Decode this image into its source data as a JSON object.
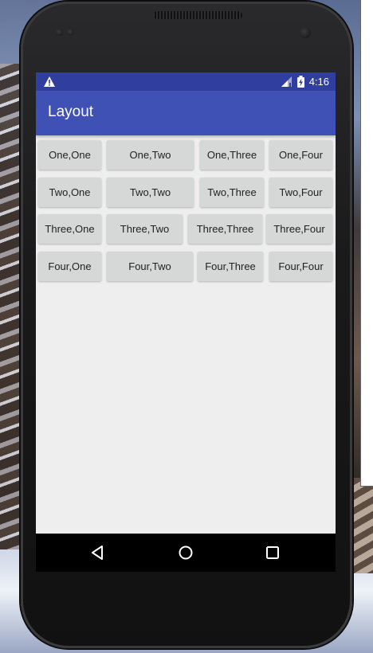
{
  "status_bar": {
    "time": "4:16",
    "icons": [
      "warning-icon",
      "signal-icon",
      "battery-charging-icon"
    ]
  },
  "app_bar": {
    "title": "Layout"
  },
  "grid": {
    "rows": [
      [
        "One,One",
        "One,Two",
        "One,Three",
        "One,Four"
      ],
      [
        "Two,One",
        "Two,Two",
        "Two,Three",
        "Two,Four"
      ],
      [
        "Three,One",
        "Three,Two",
        "Three,Three",
        "Three,Four"
      ],
      [
        "Four,One",
        "Four,Two",
        "Four,Three",
        "Four,Four"
      ]
    ]
  },
  "nav_bar": {
    "icons": [
      "back-icon",
      "home-icon",
      "recents-icon"
    ]
  },
  "colors": {
    "status_bar": "#303f9f",
    "app_bar": "#3f51b5",
    "button": "#d6d7d7",
    "background": "#eeeeee"
  }
}
